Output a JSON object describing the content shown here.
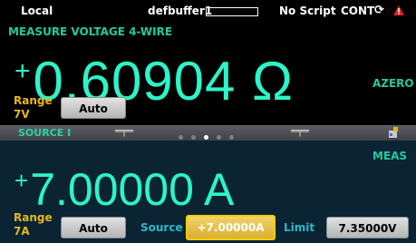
{
  "status_bar": {
    "mode": "Local",
    "buffer": "defbuffer1",
    "script": "No Script",
    "trigger": "CONT",
    "refresh_icon": "refresh-icon",
    "warning_icon": "warning-icon"
  },
  "measure": {
    "title": "MEASURE VOLTAGE 4-WIRE",
    "sign": "+",
    "value": "0.60904 Ω",
    "azero": "AZERO",
    "range_label_line1": "Range",
    "range_label_line2": "7V",
    "range_button": "Auto"
  },
  "source": {
    "header_title": "SOURCE I",
    "page_dots": 5,
    "active_dot": 2,
    "meas": "MEAS",
    "sign": "+",
    "value": "7.00000 A",
    "range_label_line1": "Range",
    "range_label_line2": "7A",
    "range_button": "Auto",
    "source_label": "Source",
    "source_value": "+7.00000A",
    "limit_label": "Limit",
    "limit_value": "7.35000V"
  },
  "colors": {
    "reading": "#2cf5c8",
    "label_green": "#27c9a0",
    "range_yellow": "#e8b81e",
    "source_bg": "#0a2434",
    "highlight": "#f4d000"
  }
}
